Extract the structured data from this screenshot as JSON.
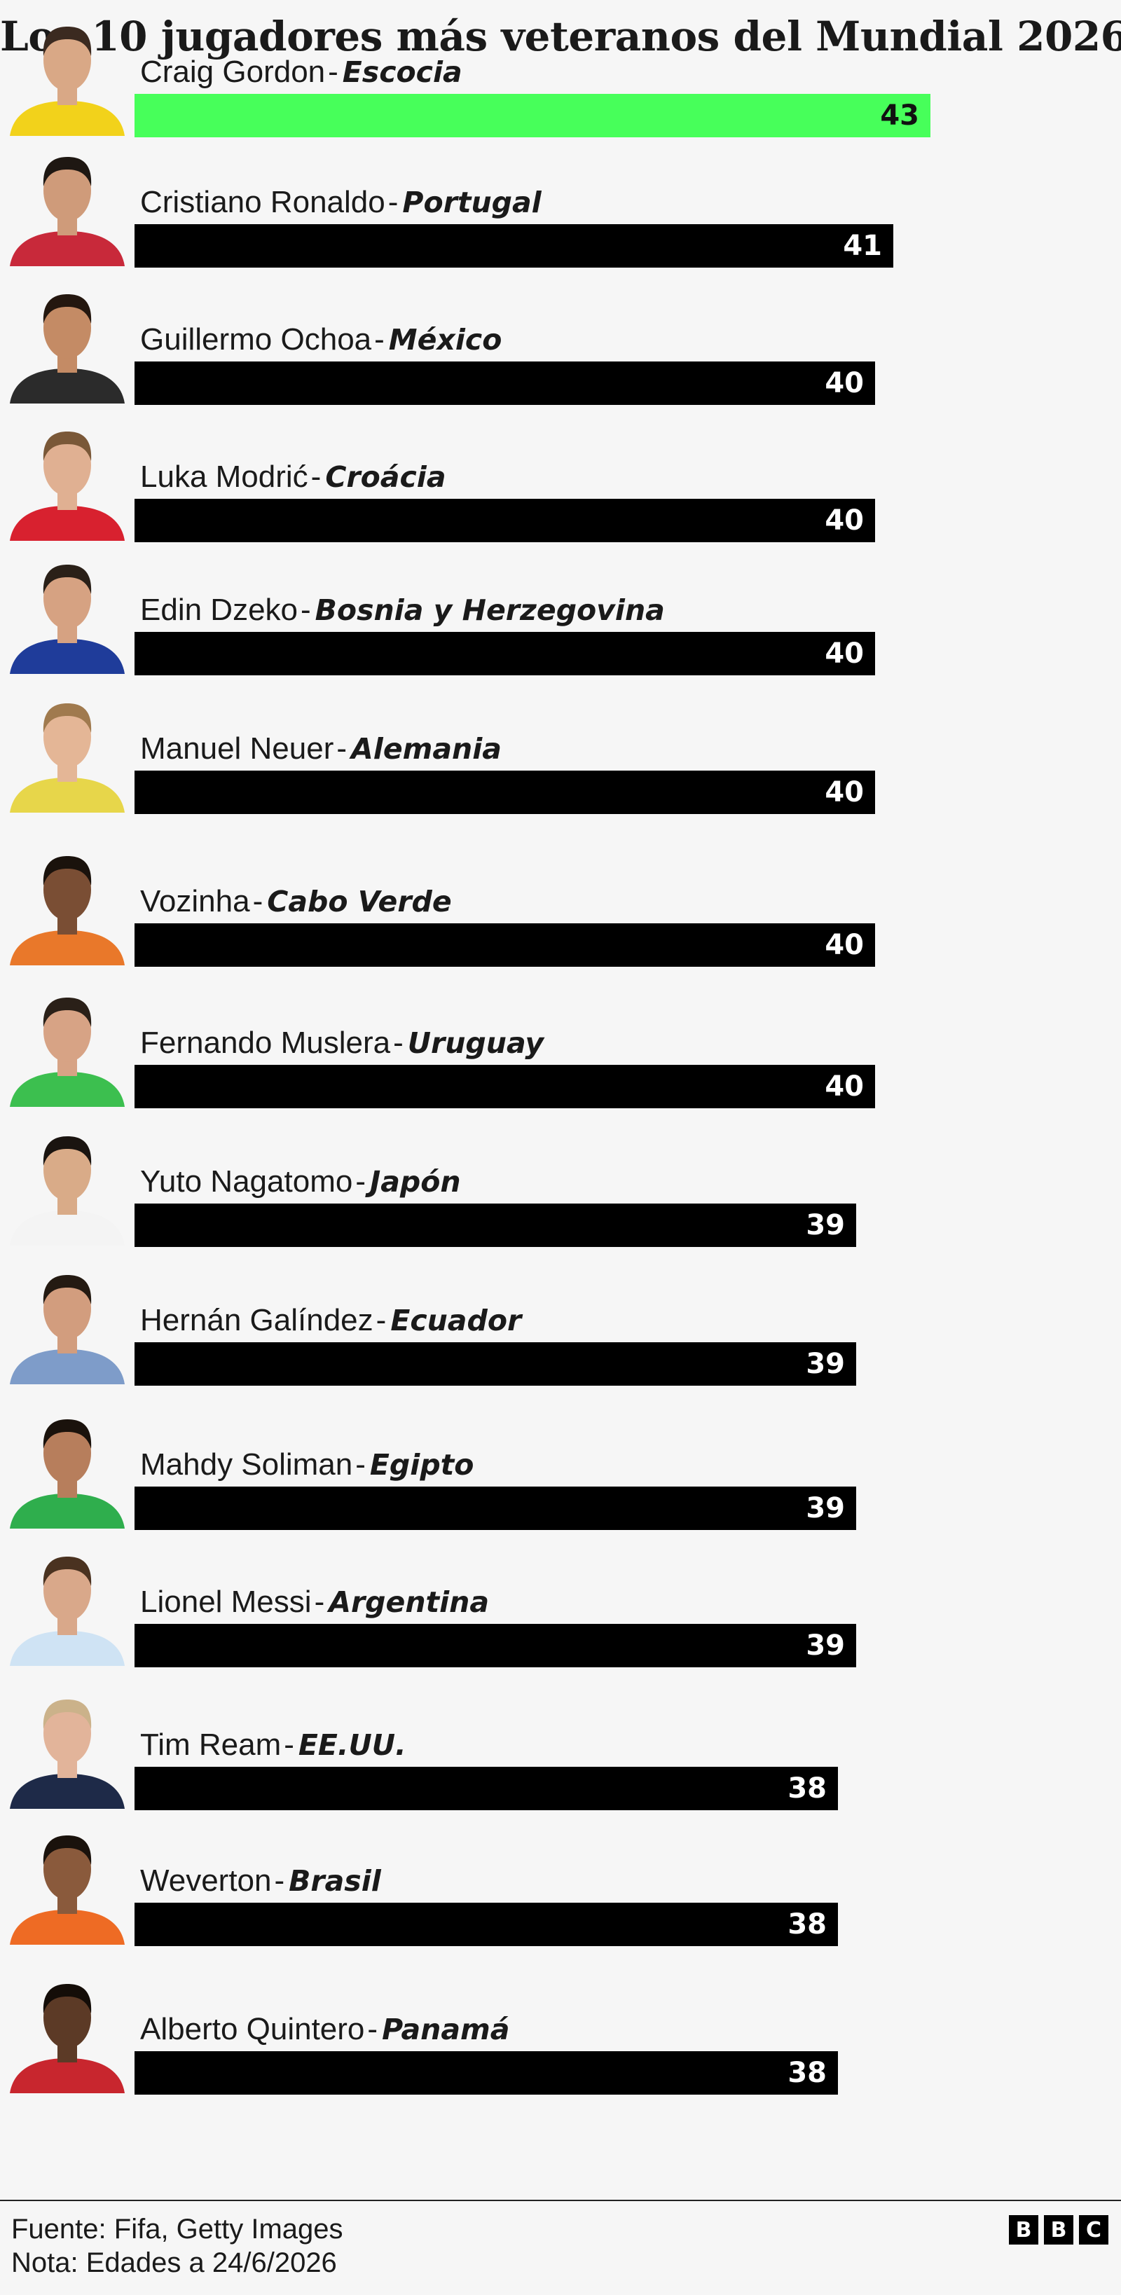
{
  "title": "Los 10 jugadores más veteranos del Mundial 2026",
  "chart_data": {
    "type": "bar",
    "orientation": "horizontal",
    "title": "Los 10 jugadores más veteranos del Mundial 2026",
    "highlight_color": "#47ff5a",
    "bar_color": "#000000",
    "xlim": [
      0,
      43
    ],
    "rows": [
      {
        "name": "Craig Gordon",
        "sep": "-",
        "country": "Escocia",
        "value": 43,
        "highlight": true,
        "shirt": "#f2d21b",
        "skin": "#d9a886",
        "hair": "#3b2a20"
      },
      {
        "name": "Cristiano Ronaldo",
        "sep": "-",
        "country": "Portugal",
        "value": 41,
        "highlight": false,
        "shirt": "#c8293a",
        "skin": "#cf9b7a",
        "hair": "#1e1712"
      },
      {
        "name": "Guillermo Ochoa",
        "sep": "-",
        "country": "México",
        "value": 40,
        "highlight": false,
        "shirt": "#2b2b2b",
        "skin": "#c48b65",
        "hair": "#24170f"
      },
      {
        "name": "Luka Modrić",
        "sep": "-",
        "country": "Croácia",
        "value": 40,
        "highlight": false,
        "shirt": "#d8212f",
        "skin": "#e0b092",
        "hair": "#7a5838"
      },
      {
        "name": "Edin Dzeko",
        "sep": "-",
        "country": "Bosnia y Herzegovina",
        "value": 40,
        "highlight": false,
        "shirt": "#1f3c9a",
        "skin": "#d6a282",
        "hair": "#2a2018"
      },
      {
        "name": "Manuel Neuer",
        "sep": "-",
        "country": "Alemania",
        "value": 40,
        "highlight": false,
        "shirt": "#e7d64a",
        "skin": "#e4b696",
        "hair": "#a07a4e"
      },
      {
        "name": "Vozinha",
        "sep": "-",
        "country": "Cabo Verde",
        "value": 40,
        "highlight": false,
        "shirt": "#e9782a",
        "skin": "#7a4e34",
        "hair": "#1a120c"
      },
      {
        "name": "Fernando Muslera",
        "sep": "-",
        "country": "Uruguay",
        "value": 40,
        "highlight": false,
        "shirt": "#3cbf4f",
        "skin": "#d7a385",
        "hair": "#2a2018"
      },
      {
        "name": "Yuto Nagatomo",
        "sep": "-",
        "country": "Japón",
        "value": 39,
        "highlight": false,
        "shirt": "#f4f4f4",
        "skin": "#d9ab88",
        "hair": "#1a1410"
      },
      {
        "name": "Hernán Galíndez",
        "sep": "-",
        "country": "Ecuador",
        "value": 39,
        "highlight": false,
        "shirt": "#7e9cc9",
        "skin": "#d29d7e",
        "hair": "#241a12"
      },
      {
        "name": "Mahdy Soliman",
        "sep": "-",
        "country": "Egipto",
        "value": 39,
        "highlight": false,
        "shirt": "#2fae4d",
        "skin": "#b77e5c",
        "hair": "#1a120c"
      },
      {
        "name": "Lionel Messi",
        "sep": "-",
        "country": "Argentina",
        "value": 39,
        "highlight": false,
        "shirt": "#cfe3f4",
        "skin": "#d9a88a",
        "hair": "#4a3220"
      },
      {
        "name": "Tim Ream",
        "sep": "-",
        "country": "EE.UU.",
        "value": 38,
        "highlight": false,
        "shirt": "#1e2a48",
        "skin": "#e2b49a",
        "hair": "#cbb28a"
      },
      {
        "name": "Weverton",
        "sep": "-",
        "country": "Brasil",
        "value": 38,
        "highlight": false,
        "shirt": "#ee6b24",
        "skin": "#8a5a3c",
        "hair": "#1a120c"
      },
      {
        "name": "Alberto Quintero",
        "sep": "-",
        "country": "Panamá",
        "value": 38,
        "highlight": false,
        "shirt": "#c8262e",
        "skin": "#5c3a26",
        "hair": "#140d08"
      }
    ]
  },
  "footer": {
    "source": "Fuente: Fifa, Getty Images",
    "note": "Nota: Edades a 24/6/2026",
    "logo": [
      "B",
      "B",
      "C"
    ]
  }
}
